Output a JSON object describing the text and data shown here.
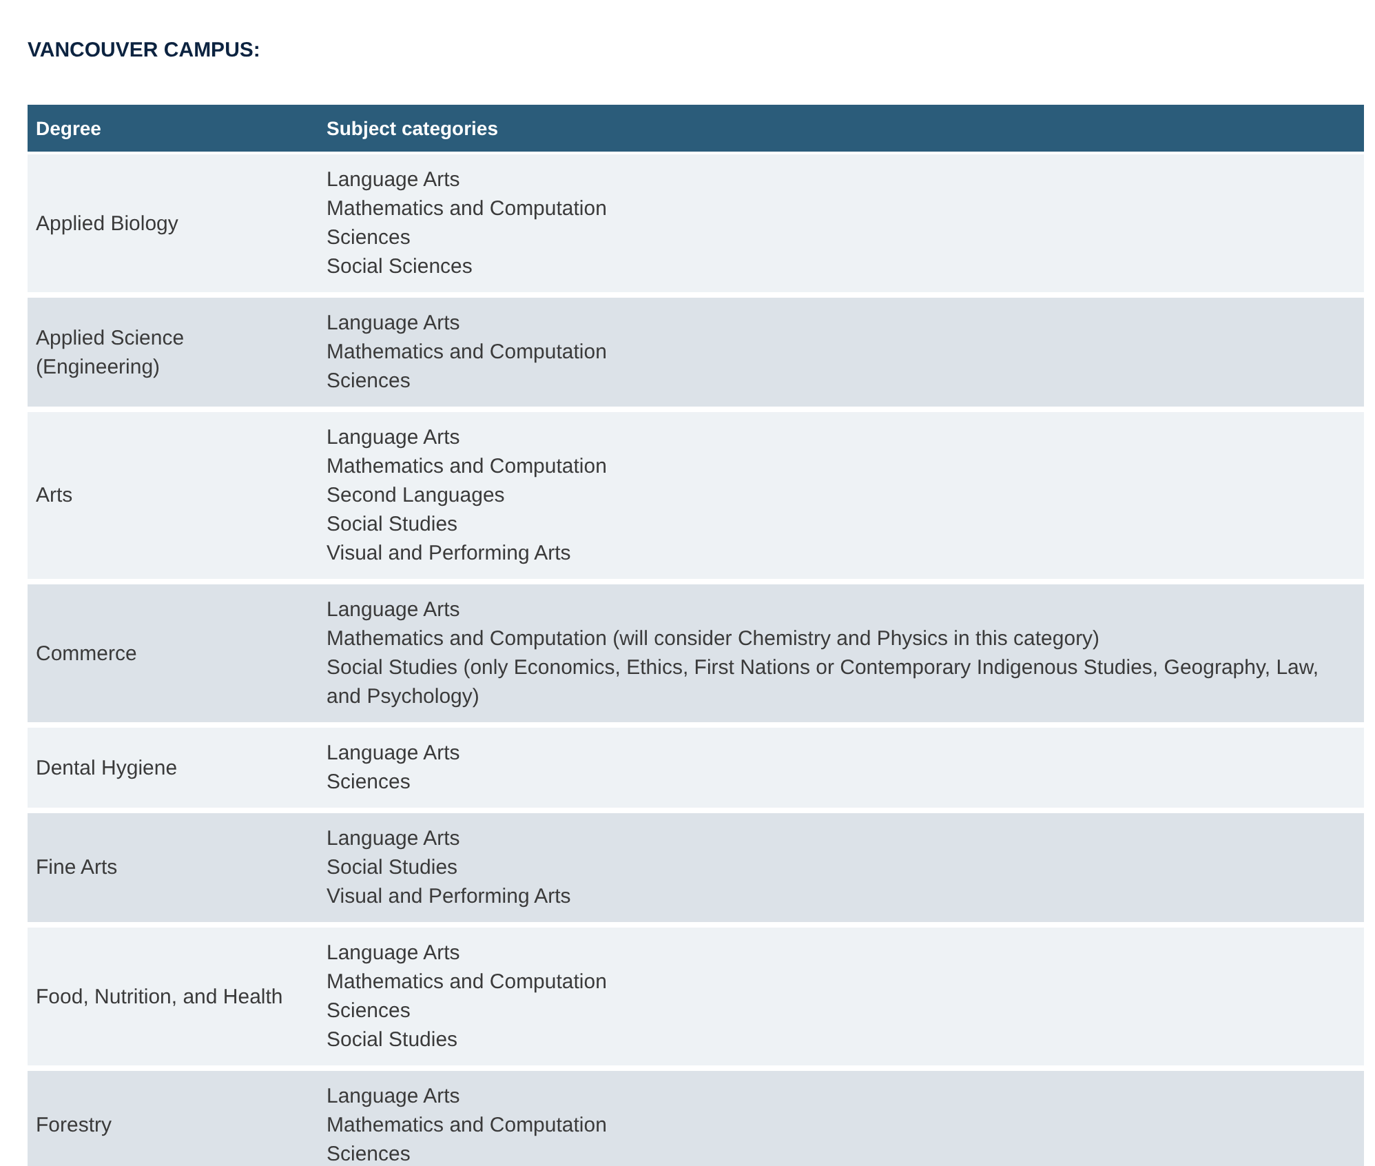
{
  "heading": "VANCOUVER CAMPUS:",
  "table": {
    "columns": [
      "Degree",
      "Subject categories"
    ],
    "rows": [
      {
        "degree": "Applied Biology",
        "subjects": [
          "Language Arts",
          "Mathematics and Computation",
          "Sciences",
          "Social Sciences"
        ]
      },
      {
        "degree": "Applied Science (Engineering)",
        "subjects": [
          "Language Arts",
          "Mathematics and Computation",
          "Sciences"
        ]
      },
      {
        "degree": "Arts",
        "subjects": [
          "Language Arts",
          "Mathematics and Computation",
          "Second Languages",
          "Social Studies",
          "Visual and Performing Arts"
        ]
      },
      {
        "degree": "Commerce",
        "subjects": [
          "Language Arts",
          "Mathematics and Computation (will consider Chemistry and Physics in this category)",
          "Social Studies (only Economics, Ethics, First Nations or Contemporary Indigenous Studies, Geography, Law, and Psychology)"
        ]
      },
      {
        "degree": "Dental Hygiene",
        "subjects": [
          "Language Arts",
          "Sciences"
        ]
      },
      {
        "degree": "Fine Arts",
        "subjects": [
          "Language Arts",
          "Social Studies",
          "Visual and Performing Arts"
        ]
      },
      {
        "degree": "Food, Nutrition, and Health",
        "subjects": [
          "Language Arts",
          "Mathematics and Computation",
          "Sciences",
          "Social Studies"
        ]
      },
      {
        "degree": "Forestry",
        "subjects": [
          "Language Arts",
          "Mathematics and Computation",
          "Sciences"
        ]
      }
    ]
  }
}
